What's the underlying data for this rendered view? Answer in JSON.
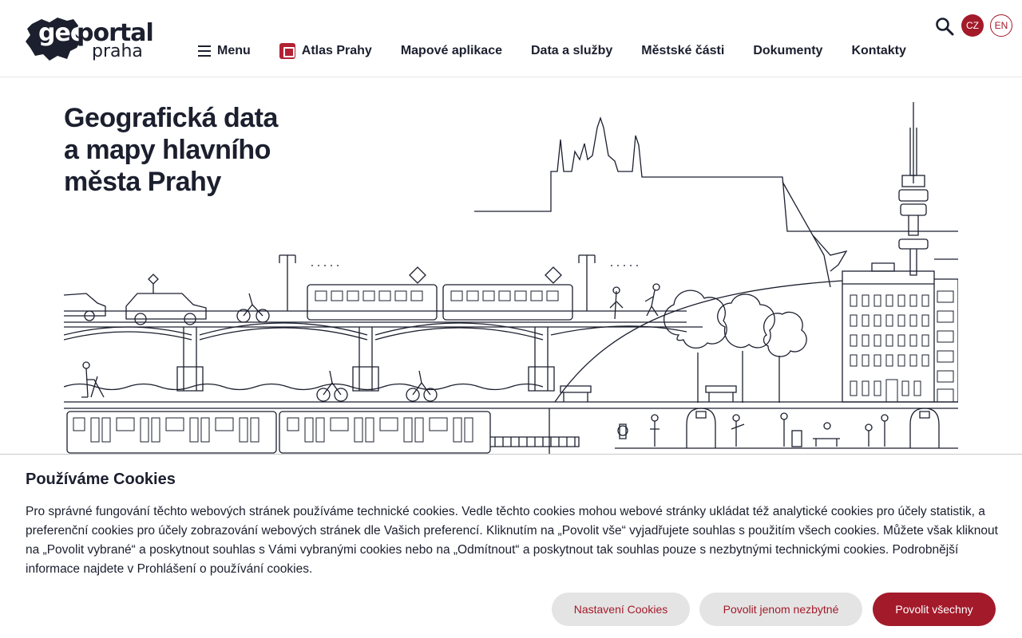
{
  "logo": {
    "geo": "geo",
    "portal": "portal",
    "city": "praha"
  },
  "nav": {
    "menu_label": "Menu",
    "atlas_label": "Atlas Prahy",
    "links": [
      "Mapové aplikace",
      "Data a služby",
      "Městské části",
      "Dokumenty",
      "Kontakty"
    ]
  },
  "header": {
    "lang_cz": "CZ",
    "lang_en": "EN"
  },
  "hero": {
    "title_line1": "Geografická data",
    "title_line2": "a mapy hlavního",
    "title_line3": "města Prahy"
  },
  "cookie": {
    "title": "Používáme Cookies",
    "text": "Pro správné fungování těchto webových stránek používáme technické cookies. Vedle těchto cookies mohou webové stránky ukládat též analytické cookies pro účely statistik, a preferenční cookies pro účely zobrazování webových stránek dle Vašich preferencí. Kliknutím na „Povolit vše“ vyjadřujete souhlas s použitím všech cookies. Můžete však kliknout na „Povolit vybrané“ a poskytnout souhlas s Vámi vybranými cookies nebo na „Odmítnout“ a poskytnout tak souhlas pouze s nezbytnými technickými cookies. Podrobnější informace najdete v Prohlášení o používání cookies.",
    "btn_settings": "Nastavení Cookies",
    "btn_necessary": "Povolit jenom nezbytné",
    "btn_all": "Povolit všechny"
  },
  "colors": {
    "brand": "#a31a2a",
    "text": "#1b1f2e",
    "button_grey": "#e4e4e4"
  },
  "icons": [
    "hamburger-icon",
    "atlas-map-icon",
    "search-icon"
  ]
}
